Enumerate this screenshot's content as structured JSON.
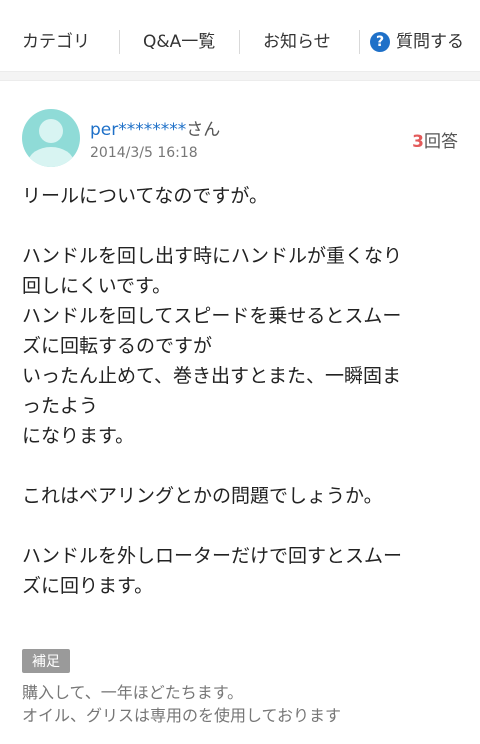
{
  "nav": {
    "category": "カテゴリ",
    "qa_list": "Q&A一覧",
    "notice": "お知らせ",
    "ask_icon": "?",
    "ask": "質問する"
  },
  "question": {
    "user": "per********",
    "user_suffix": "さん",
    "date": "2014/3/5 16:18",
    "answer_count": "3",
    "answer_label": "回答",
    "body": "リールについてなのですが。\n\nハンドルを回し出す時にハンドルが重くなり\n回しにくいです。\nハンドルを回してスピードを乗せるとスムー\nズに回転するのですが\nいったん止めて、巻き出すとまた、一瞬固ま\nったよう\nになります。\n\nこれはベアリングとかの問題でしょうか。\n\nハンドルを外しローターだけで回すとスムー\nズに回ります。",
    "supplement_label": "補足",
    "supplement": "購入して、一年ほどたちます。\nオイル、グリスは専用のを使用しております"
  },
  "colors": {
    "link": "#1e70c8",
    "answer_count": "#e35a5a",
    "avatar": "#8fdbd7"
  }
}
